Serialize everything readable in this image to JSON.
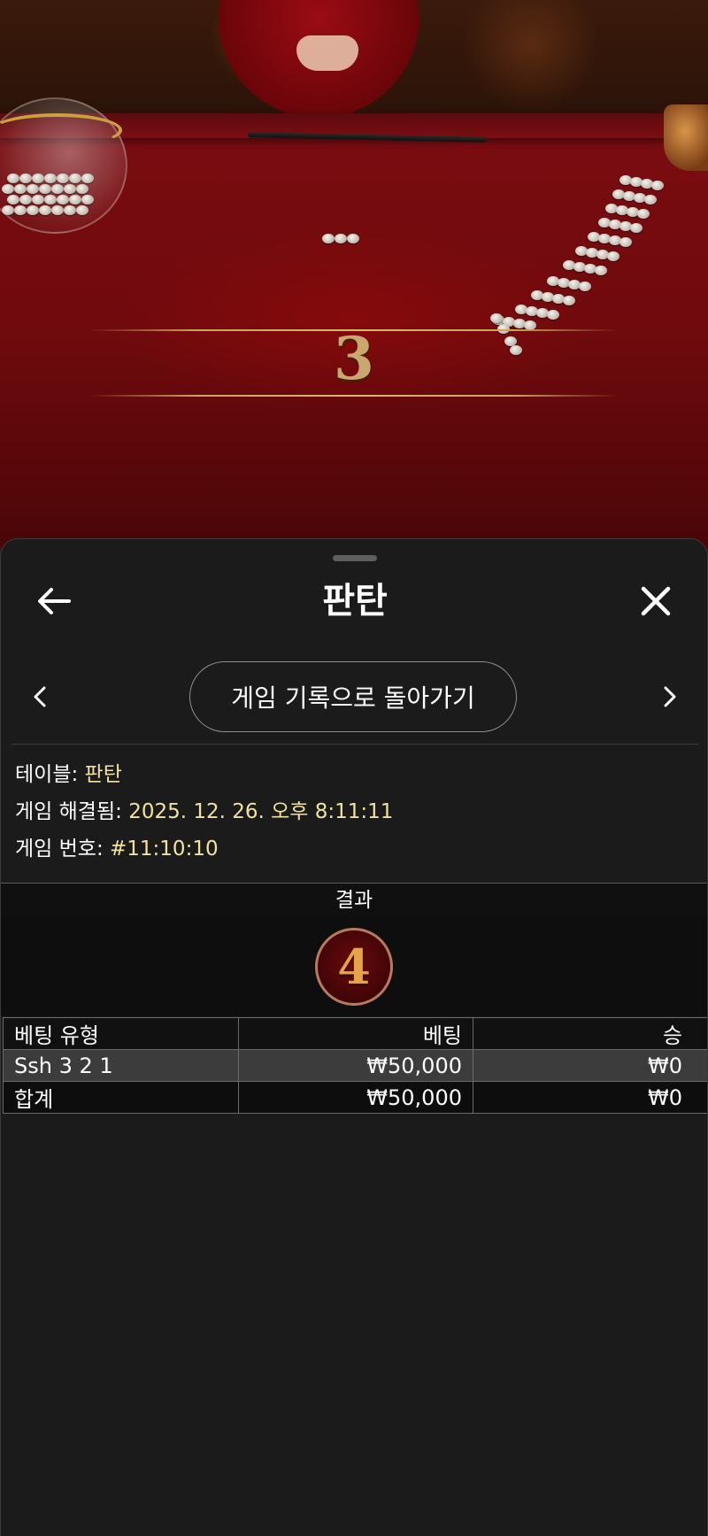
{
  "video": {
    "current_number": "3"
  },
  "sheet": {
    "title": "판탄",
    "back_icon": "arrow-left-icon",
    "close_icon": "close-icon",
    "prev_icon": "chevron-left-icon",
    "next_icon": "chevron-right-icon",
    "history_button_label": "게임 기록으로 돌아가기"
  },
  "info": {
    "table_label": "테이블:",
    "table_value": "판탄",
    "resolved_label": "게임 해결됨:",
    "resolved_value": "2025. 12. 26. 오후 8:11:11",
    "game_no_label": "게임 번호:",
    "game_no_value": "#11:10:10"
  },
  "result": {
    "header": "결과",
    "value": "4"
  },
  "bets_table": {
    "columns": [
      "베팅 유형",
      "베팅",
      "승"
    ],
    "rows": [
      [
        "Ssh 3 2 1",
        "₩50,000",
        "₩0"
      ]
    ],
    "total": [
      "합계",
      "₩50,000",
      "₩0"
    ]
  },
  "colors": {
    "accent_value": "#f2e2a0",
    "result_number": "#e7a447",
    "sheet_bg": "#1b1b1b"
  }
}
